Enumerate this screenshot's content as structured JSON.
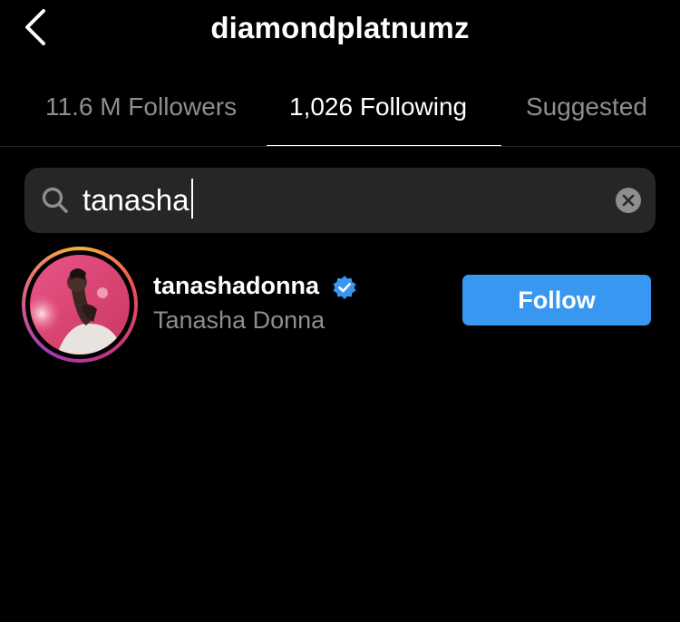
{
  "header": {
    "title": "diamondplatnumz",
    "back_icon": "chevron-left-icon"
  },
  "tabs": [
    {
      "label": "11.6 M Followers",
      "active": false
    },
    {
      "label": "1,026 Following",
      "active": true
    },
    {
      "label": "Suggested",
      "active": false
    }
  ],
  "search": {
    "value": "tanasha",
    "icon": "search-icon",
    "clear_icon": "clear-icon"
  },
  "results": [
    {
      "username": "tanashadonna",
      "full_name": "Tanasha Donna",
      "verified": true,
      "button_label": "Follow"
    }
  ],
  "colors": {
    "background": "#000000",
    "accent": "#3897f0",
    "secondary_text": "#8e8e8e",
    "search_bg": "#262626"
  }
}
